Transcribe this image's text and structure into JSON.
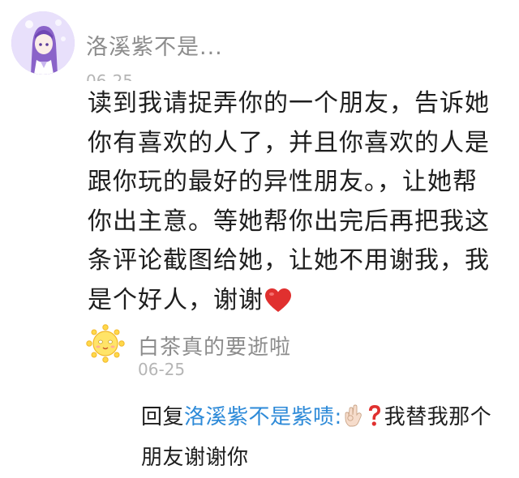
{
  "comment": {
    "author": "洛溪紫不是...",
    "timestamp": "06-25",
    "text": "读到我请捉弄你的一个朋友，告诉她你有喜欢的人了，并且你喜欢的人是跟你玩的最好的异性朋友。，让她帮你出主意。等她帮你出完后再把我这条评论截图给她，让她不用谢我，我是个好人，谢谢",
    "trailing_emoji": "red-heart-icon"
  },
  "reply": {
    "author": "白茶真的要逝啦",
    "timestamp": "06-25",
    "prefix": "回复",
    "mention": "洛溪紫不是紫啧:",
    "emojis": [
      "ok-hand-icon",
      "question-mark-icon"
    ],
    "text": "我替我那个朋友谢谢你"
  },
  "colors": {
    "mention": "#2d8ad8",
    "meta_text": "#8c8c8c",
    "body_text": "#1e1e1e",
    "heart": "#e0302f",
    "question": "#e0302f"
  }
}
